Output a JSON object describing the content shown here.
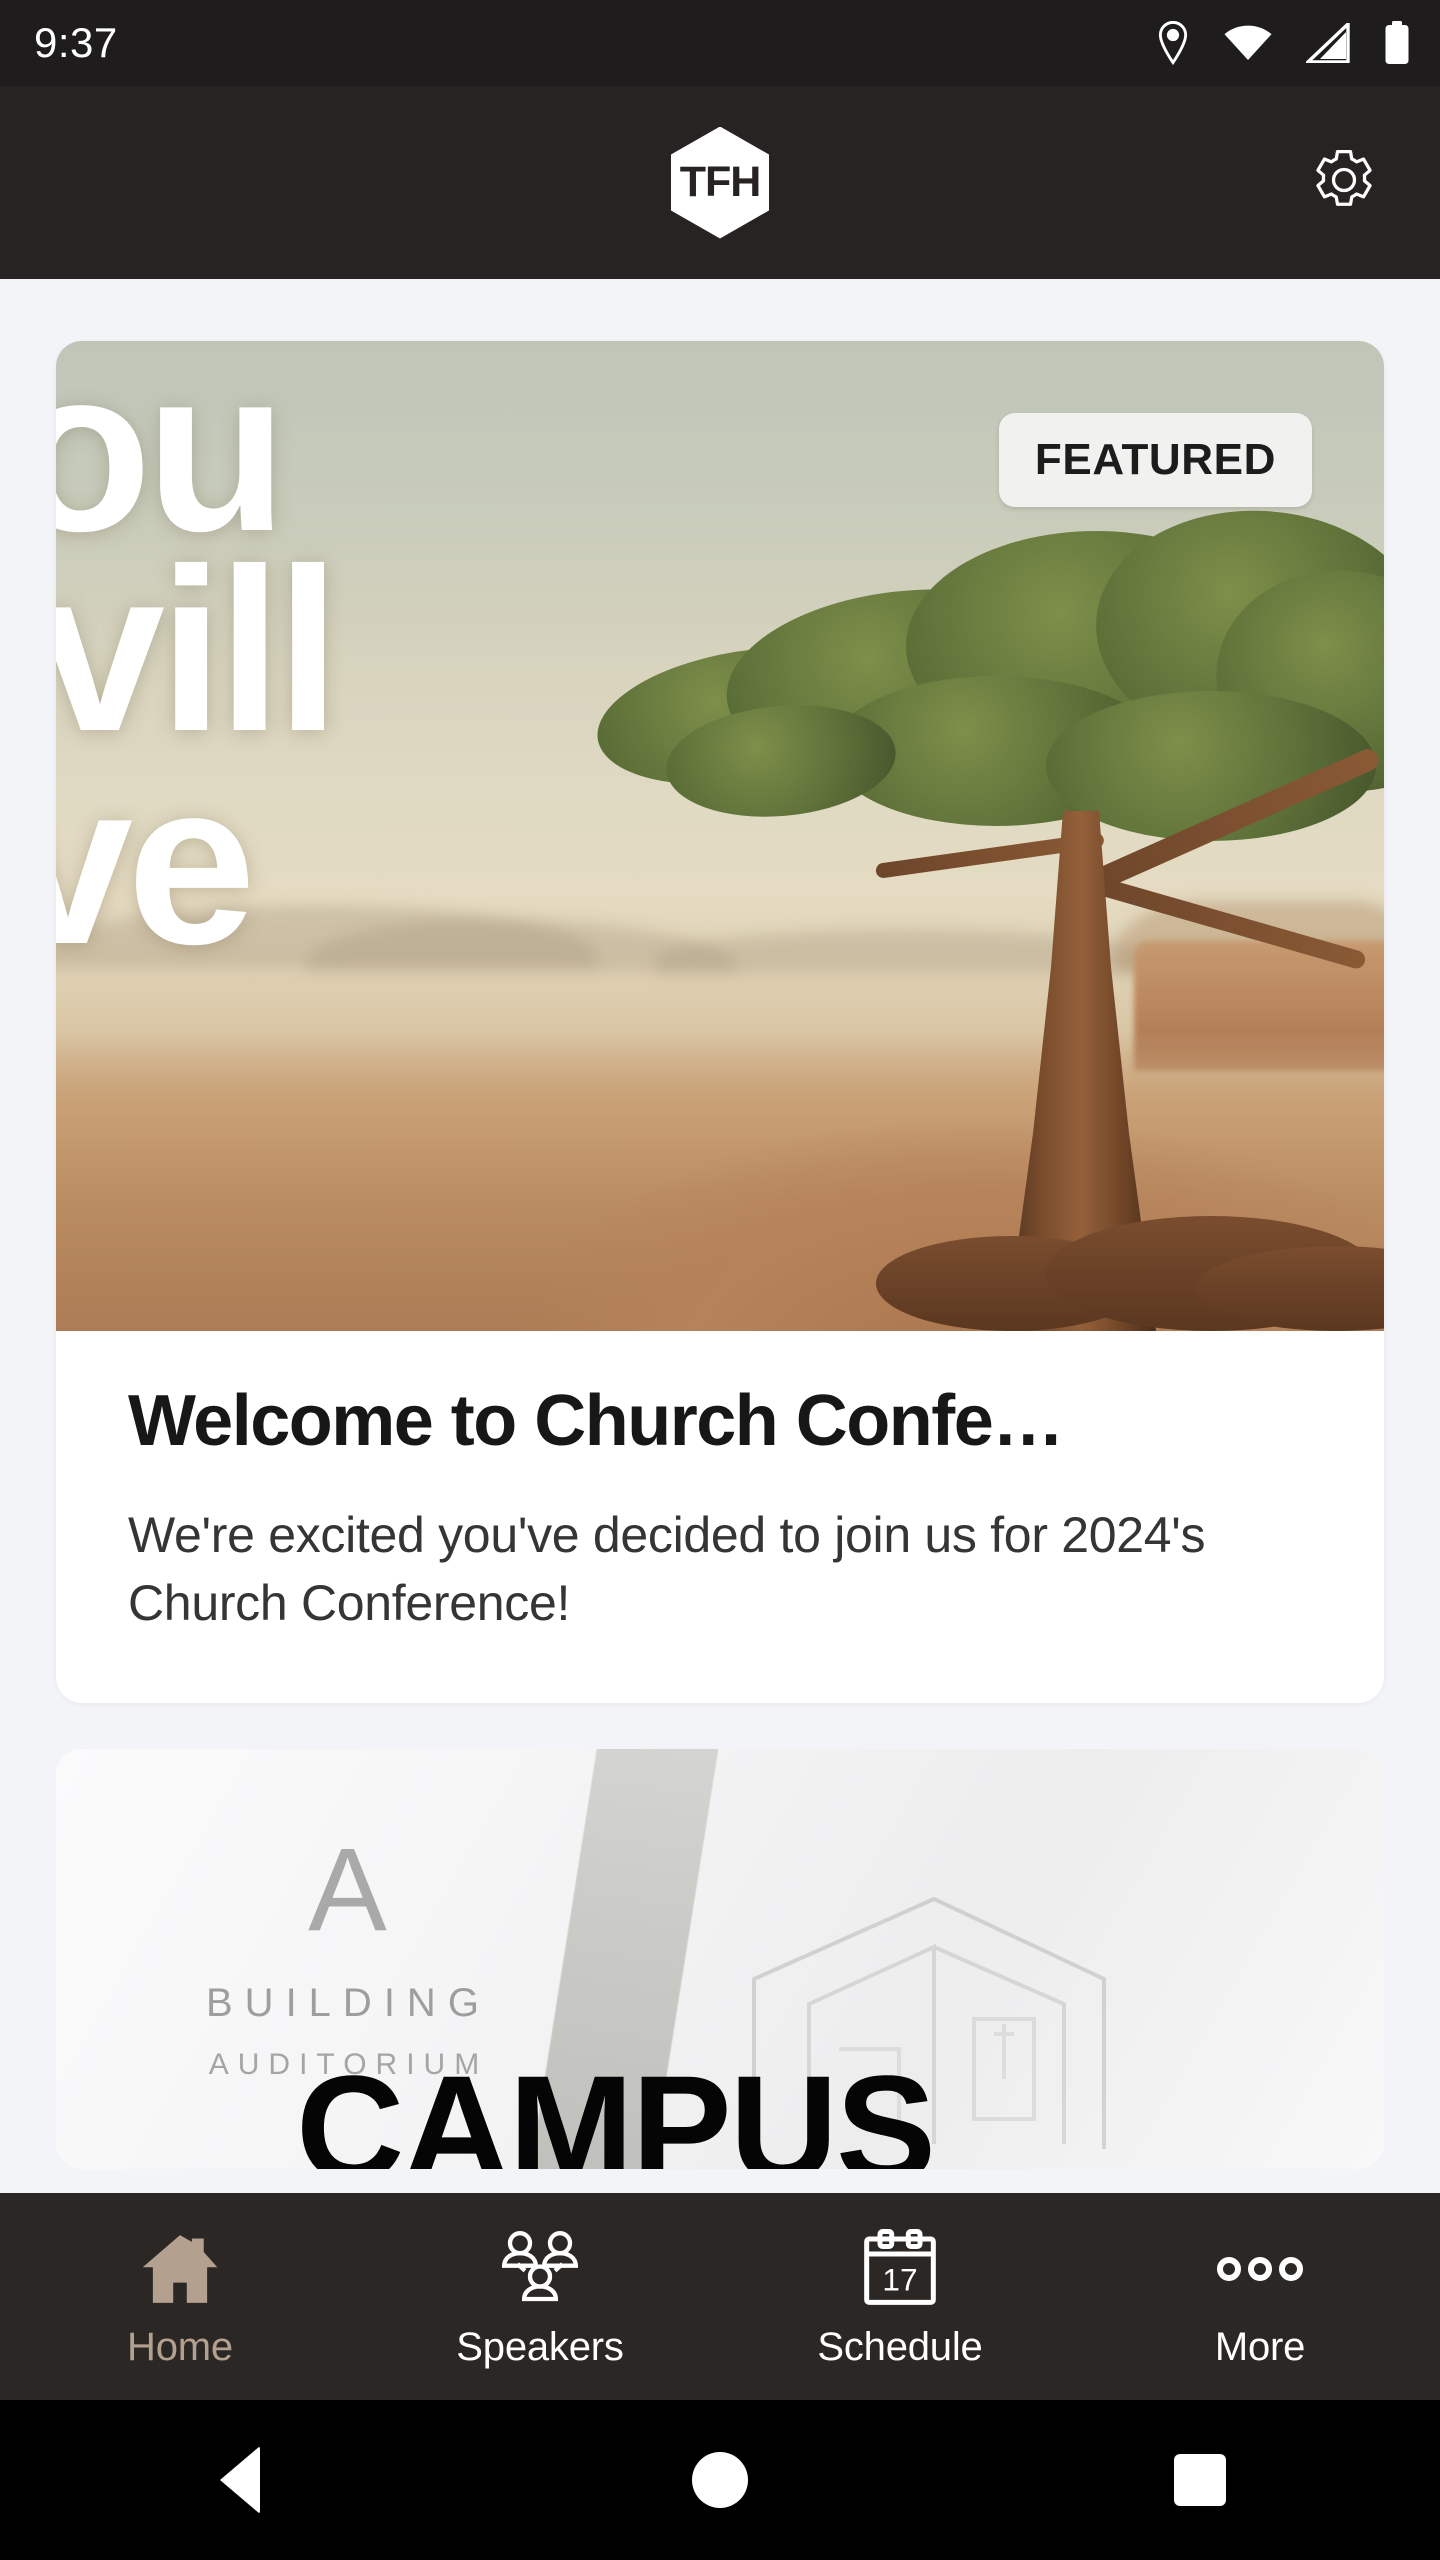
{
  "status_bar": {
    "time": "9:37",
    "icons": [
      "location-pin-icon",
      "wifi-icon",
      "cellular-signal-icon",
      "battery-icon"
    ]
  },
  "app_bar": {
    "logo_text": "TFH",
    "settings_icon": "gear-icon"
  },
  "featured_card": {
    "badge": "FEATURED",
    "hero_overlay_lines": [
      "ou",
      "vill",
      "ve"
    ],
    "hero_image_alt": "acacia-tree-desert",
    "title": "Welcome to Church Confe…",
    "description": "We're excited you've decided to join us for 2024's Church Conference!"
  },
  "second_card": {
    "letter": "A",
    "building": "BUILDING",
    "auditorium": "AUDITORIUM",
    "campus": "CAMPUS"
  },
  "bottom_nav": {
    "items": [
      {
        "label": "Home",
        "icon": "home-icon",
        "active": true
      },
      {
        "label": "Speakers",
        "icon": "people-group-icon",
        "active": false
      },
      {
        "label": "Schedule",
        "icon": "calendar-icon",
        "active": false
      },
      {
        "label": "More",
        "icon": "ellipsis-icon",
        "active": false
      }
    ],
    "calendar_day": "17"
  },
  "android_nav": {
    "back": "back-button",
    "home": "home-button",
    "recents": "recents-button"
  },
  "colors": {
    "status_bar_bg": "#1e1c1c",
    "app_bar_bg": "#272322",
    "page_bg": "#f3f4f8",
    "card_bg": "#ffffff",
    "nav_bg": "#2b2725",
    "accent": "#b3a08f",
    "badge_bg": "#f1f1f0",
    "text_dark": "#171717"
  }
}
